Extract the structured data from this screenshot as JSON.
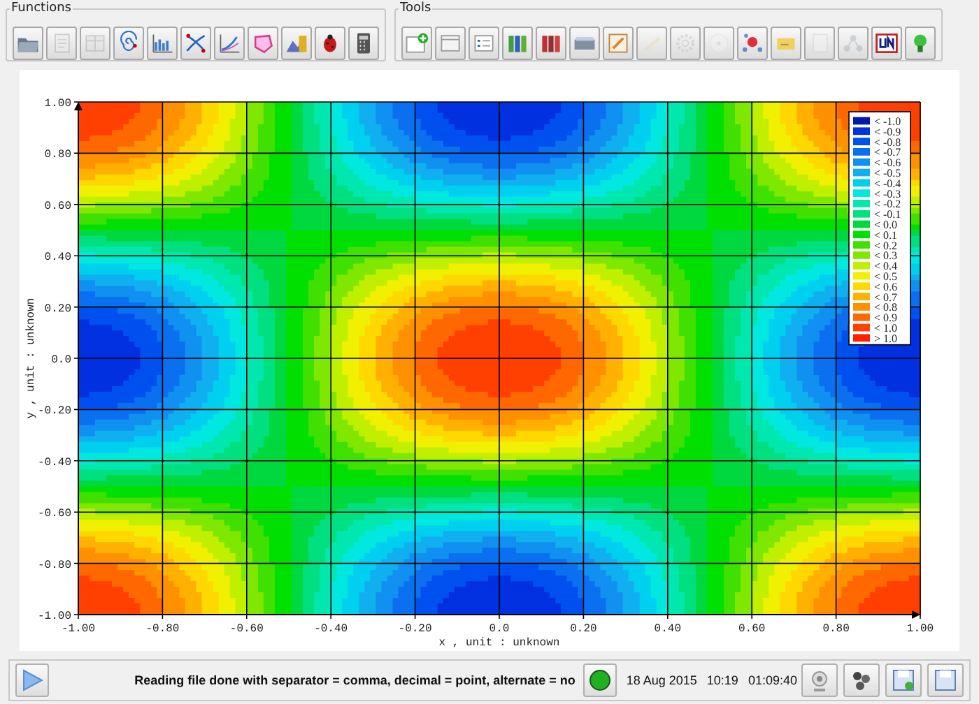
{
  "toolbars": [
    {
      "title": "Functions",
      "buttons": [
        {
          "disabled": false
        },
        {
          "disabled": true
        },
        {
          "disabled": true
        },
        {
          "disabled": false
        },
        {
          "disabled": false
        },
        {
          "disabled": false
        },
        {
          "disabled": false
        },
        {
          "disabled": false
        },
        {
          "disabled": false
        },
        {
          "disabled": false
        },
        {
          "disabled": false
        }
      ]
    },
    {
      "title": "Tools",
      "buttons": [
        {
          "disabled": false
        },
        {
          "disabled": false
        },
        {
          "disabled": false
        },
        {
          "disabled": false
        },
        {
          "disabled": false
        },
        {
          "disabled": false
        },
        {
          "disabled": false
        },
        {
          "disabled": true
        },
        {
          "disabled": true
        },
        {
          "disabled": true
        },
        {
          "disabled": false
        },
        {
          "disabled": false
        },
        {
          "disabled": true
        },
        {
          "disabled": true
        },
        {
          "disabled": false
        },
        {
          "disabled": false
        }
      ]
    }
  ],
  "plot": {
    "xlabel": "x , unit : unknown",
    "ylabel": "y , unit : unknown",
    "xticks": [
      "-1.00",
      "-0.80",
      "-0.60",
      "-0.40",
      "-0.20",
      "0.0",
      "0.20",
      "0.40",
      "0.60",
      "0.80",
      "1.00"
    ],
    "yticks": [
      "1.00",
      "0.80",
      "0.60",
      "0.40",
      "0.20",
      "0.0",
      "-0.20",
      "-0.40",
      "-0.60",
      "-0.80",
      "-1.00"
    ],
    "legend": [
      {
        "label": "< -1.0",
        "color": "#0018b0"
      },
      {
        "label": "< -0.9",
        "color": "#0030e0"
      },
      {
        "label": "< -0.8",
        "color": "#0050f0"
      },
      {
        "label": "< -0.7",
        "color": "#0a70f0"
      },
      {
        "label": "< -0.6",
        "color": "#1090f0"
      },
      {
        "label": "< -0.5",
        "color": "#10b0f0"
      },
      {
        "label": "< -0.4",
        "color": "#00d0f0"
      },
      {
        "label": "< -0.3",
        "color": "#00e8e0"
      },
      {
        "label": "< -0.2",
        "color": "#00e8b0"
      },
      {
        "label": "< -0.1",
        "color": "#00e080"
      },
      {
        "label": "< 0.0",
        "color": "#00d840"
      },
      {
        "label": "< 0.1",
        "color": "#00e000"
      },
      {
        "label": "< 0.2",
        "color": "#40e000"
      },
      {
        "label": "< 0.3",
        "color": "#80e800"
      },
      {
        "label": "< 0.4",
        "color": "#c0f000"
      },
      {
        "label": "< 0.5",
        "color": "#f0f000"
      },
      {
        "label": "< 0.6",
        "color": "#ffd800"
      },
      {
        "label": "< 0.7",
        "color": "#ffb000"
      },
      {
        "label": "< 0.8",
        "color": "#ff9000"
      },
      {
        "label": "< 0.9",
        "color": "#ff6800"
      },
      {
        "label": "< 1.0",
        "color": "#ff4000"
      },
      {
        "label": "> 1.0",
        "color": "#ff2000"
      }
    ]
  },
  "status_bar": {
    "message": "Reading file done with separator = comma, decimal = point, alternate = no",
    "indicator": {
      "on": true
    },
    "date": "18 Aug 2015",
    "time": "10:19",
    "elapsed": "01:09:40"
  }
}
